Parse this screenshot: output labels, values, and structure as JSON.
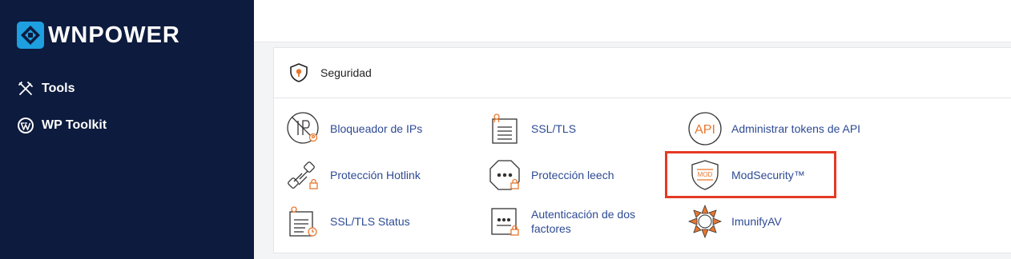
{
  "brand": {
    "name": "WNPOWER",
    "accent": "#1e9fe0",
    "sidebar_bg": "#0d1b3e",
    "logo_icon": "cube-logo-icon"
  },
  "sidebar": {
    "items": [
      {
        "label": "Tools",
        "icon": "tools-icon"
      },
      {
        "label": "WP Toolkit",
        "icon": "wordpress-icon"
      }
    ]
  },
  "section": {
    "title": "Seguridad",
    "icon": "shield-icon",
    "items": [
      {
        "label": "Bloqueador de IPs",
        "icon": "ip-blocker-icon"
      },
      {
        "label": "SSL/TLS",
        "icon": "certificate-icon"
      },
      {
        "label": "Administrar tokens de API",
        "icon": "api-icon"
      },
      {
        "label": "Protección Hotlink",
        "icon": "hotlink-icon"
      },
      {
        "label": "Protección leech",
        "icon": "leech-icon"
      },
      {
        "label": "ModSecurity™",
        "icon": "modsecurity-icon"
      },
      {
        "label": "SSL/TLS Status",
        "icon": "ssl-status-icon"
      },
      {
        "label": "Autenticación de dos factores",
        "icon": "two-factor-icon"
      },
      {
        "label": "ImunifyAV",
        "icon": "imunify-icon"
      }
    ]
  },
  "colors": {
    "link": "#2d4a94",
    "icon_orange": "#e8772e",
    "highlight": "#e53a24"
  }
}
